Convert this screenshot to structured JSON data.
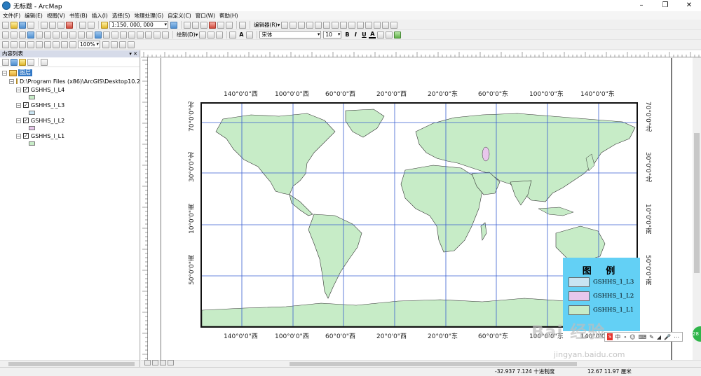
{
  "window": {
    "title": "无标题 - ArcMap"
  },
  "menu": [
    "文件(F)",
    "编辑(E)",
    "视图(V)",
    "书签(B)",
    "插入(I)",
    "选择(S)",
    "地理处理(G)",
    "自定义(C)",
    "窗口(W)",
    "帮助(H)"
  ],
  "toolbar": {
    "scale": "1:150, 000, 000",
    "editor_label": "编辑器(R)▾",
    "draw_label": "绘制(D)▾",
    "font_name": "宋体",
    "font_size": "10",
    "bold": "B",
    "italic": "I",
    "underline": "U",
    "text_tool": "A",
    "zoom": "100%"
  },
  "toc": {
    "title": "内容列表",
    "pin": "▾ ✕",
    "root": "图层",
    "folder": "D:\\Program Files (x86)\\ArcGIS\\Desktop10.2",
    "layers": [
      {
        "name": "GSHHS_l_L4",
        "color": "#c7ecc7"
      },
      {
        "name": "GSHHS_l_L3",
        "color": "#c9e4f2"
      },
      {
        "name": "GSHHS_l_L2",
        "color": "#e8c7ec"
      },
      {
        "name": "GSHHS_l_L1",
        "color": "#c7ecc7"
      }
    ]
  },
  "map": {
    "top_labels": [
      "140°0'0\"西",
      "100°0'0\"西",
      "60°0'0\"西",
      "20°0'0\"西",
      "20°0'0\"东",
      "60°0'0\"东",
      "100°0'0\"东",
      "140°0'0\"东"
    ],
    "bottom_labels": [
      "140°0'0\"西",
      "100°0'0\"西",
      "60°0'0\"西",
      "20°0'0\"西",
      "20°0'0\"东",
      "60°0'0\"东",
      "100°0'0\"东",
      "140°0'0\"东"
    ],
    "left_labels": [
      "70°0'0\"北",
      "30°0'0\"北",
      "10°0'0\"南",
      "50°0'0\"南"
    ],
    "right_labels": [
      "70°0'0\"北",
      "30°0'0\"北",
      "10°0'0\"南",
      "50°0'0\"南"
    ],
    "land_color": "#c7ecc7",
    "grid_color": "#3a5fd0"
  },
  "legend": {
    "title": "图 例",
    "background": "#63d0f5",
    "items": [
      {
        "label": "GSHHS_1_L3",
        "color": "#c9e4f2"
      },
      {
        "label": "GSHHS_1_L2",
        "color": "#e8c7ec"
      },
      {
        "label": "GSHHS_1_L1",
        "color": "#c7ecc7"
      }
    ]
  },
  "status": {
    "coords": "-32.937  7.124 十进制度",
    "page_coords": "12.67  11.97 厘米"
  },
  "overlay": {
    "watermark": "Bai 经验",
    "watermark_url": "jingyan.baidu.com",
    "ime_logo": "S",
    "ime_items": [
      "中",
      "∘",
      "☺",
      "⌨",
      "✎",
      "◢",
      "🎤",
      "⋯"
    ],
    "badge": "28"
  }
}
